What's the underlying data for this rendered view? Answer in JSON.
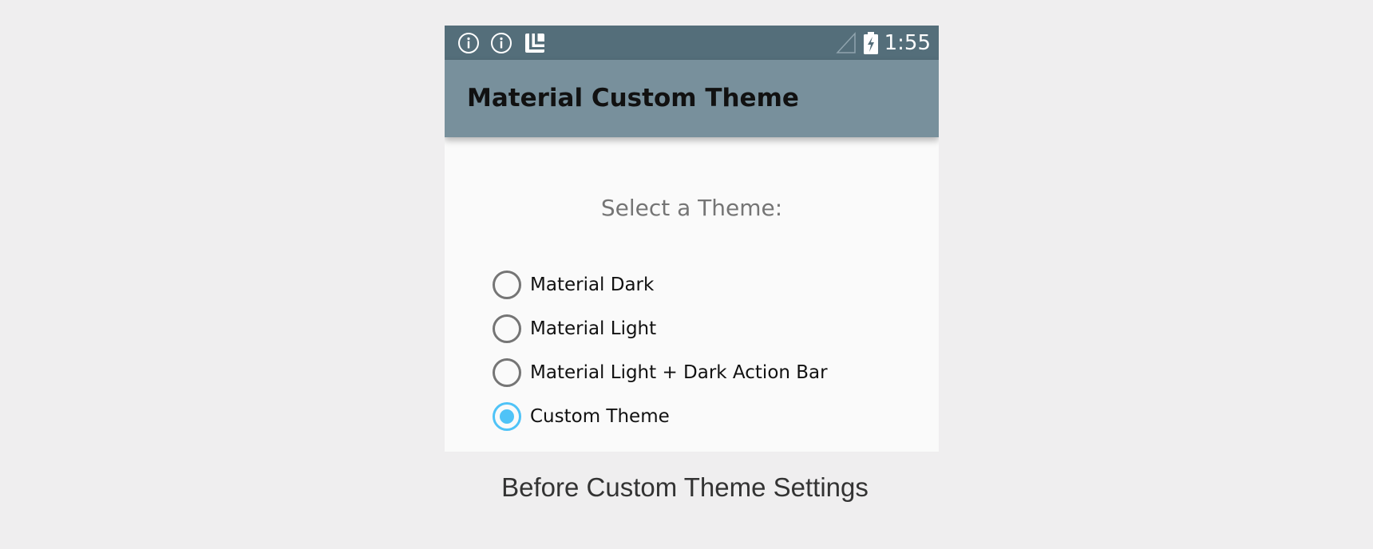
{
  "status_bar": {
    "time": "1:55",
    "icons": [
      "info-icon",
      "info-icon",
      "launcher-icon",
      "signal-icon",
      "battery-charging-icon"
    ],
    "color": "#546e7a"
  },
  "app_bar": {
    "title": "Material Custom Theme",
    "color": "#78909c"
  },
  "content": {
    "select_label": "Select a Theme:",
    "options": [
      {
        "label": "Material Dark",
        "checked": false
      },
      {
        "label": "Material Light",
        "checked": false
      },
      {
        "label": "Material Light + Dark Action Bar",
        "checked": false
      },
      {
        "label": "Custom Theme",
        "checked": true
      }
    ],
    "accent_color": "#4fc3f7"
  },
  "caption": "Before Custom Theme Settings"
}
